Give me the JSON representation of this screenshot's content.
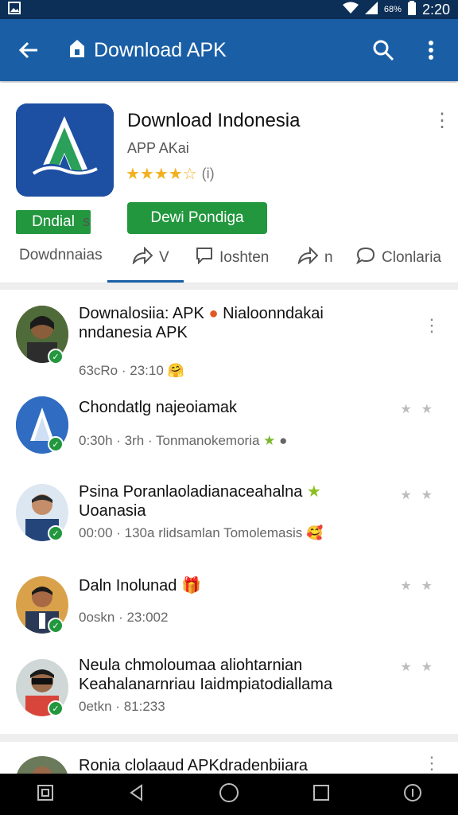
{
  "status": {
    "time": "2:20",
    "battery": "68%"
  },
  "appbar": {
    "title": "Download APK"
  },
  "app": {
    "name": "Download Indonesia",
    "developer": "APP AKai",
    "rating": "★★★★☆",
    "count": "(i)",
    "tag": "Dndial",
    "tag_suffix": "s",
    "install_label": "Dewi Pondiga"
  },
  "tabs": [
    {
      "label": "Dowdnnaias"
    },
    {
      "label": "V"
    },
    {
      "label": "Ioshten"
    },
    {
      "label": "n"
    },
    {
      "label": "Clonlaria"
    }
  ],
  "items": [
    {
      "title_line1": "Downalosiia: APK",
      "title_line1b": "Nialoonndakai",
      "title_line2": "nndanesia APK",
      "meta": "63cRo · 23:10",
      "emoji": "🤗"
    },
    {
      "title_line1": "Chondatlg najeoiamak",
      "meta": "0:30h · 3rh · Tonmanokemoria",
      "emoji": "★"
    },
    {
      "title_line1": "Psina Poranlaoladianaceahalna",
      "title_line2": "Uoanasia",
      "meta": "00:00 · 130a rlidsamlan Tomolemasis",
      "emoji": "🥰"
    },
    {
      "title_line1": "Daln Inolunad",
      "meta": "0oskn · 23:002",
      "emoji": "🎁"
    },
    {
      "title_line1": "Neula chmoloumaa aliohtarnian",
      "title_line2": "Keahalanarnriau Iaidmpiatodiallama",
      "meta": "0etkn · 81:233"
    },
    {
      "title_line1": "Ronia clolaaud APKdradenbiiara"
    }
  ],
  "colors": {
    "appbar": "#1a5fa6",
    "statusbar": "#0c2f57",
    "accent_green": "#22973e",
    "star": "#f2b01e"
  }
}
